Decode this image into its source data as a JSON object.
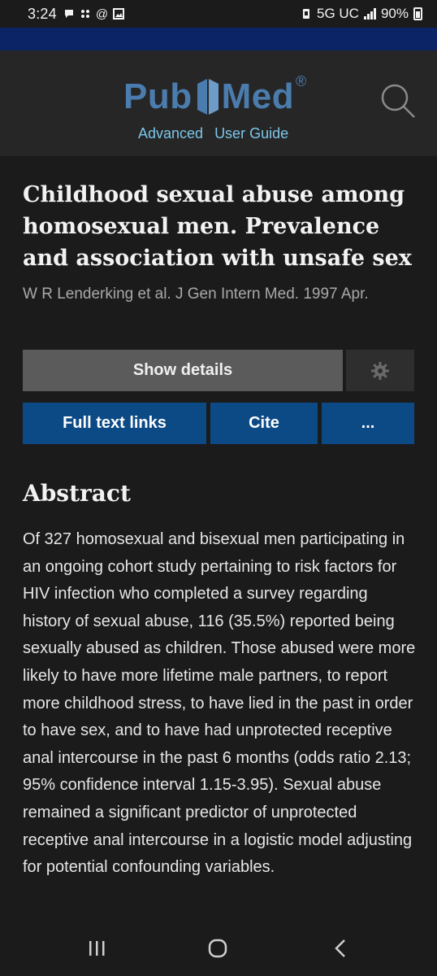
{
  "status_bar": {
    "time": "3:24",
    "network": "5G UC",
    "battery": "90%"
  },
  "header": {
    "logo_left": "Pub",
    "logo_right": "Med",
    "logo_mark": "®",
    "links": [
      "Advanced",
      "User Guide"
    ]
  },
  "article": {
    "title": "Childhood sexual abuse among homosexual men. Prevalence and association with unsafe sex",
    "citation": "W R Lenderking et al. J Gen Intern Med. 1997 Apr."
  },
  "actions": {
    "show_details": "Show details",
    "full_text_links": "Full text links",
    "cite": "Cite",
    "more": "..."
  },
  "abstract": {
    "heading": "Abstract",
    "text": "Of 327 homosexual and bisexual men participating in an ongoing cohort study pertaining to risk factors for HIV infection who completed a survey regarding history of sexual abuse, 116 (35.5%) reported being sexually abused as children. Those abused were more likely to have more lifetime male partners, to report more childhood stress, to have lied in the past in order to have sex, and to have had unprotected receptive anal intercourse in the past 6 months (odds ratio 2.13; 95% confidence interval 1.15-3.95). Sexual abuse remained a significant predictor of unprotected receptive anal intercourse in a logistic model adjusting for potential confounding variables."
  },
  "icons": {
    "search": "search-icon",
    "settings": "gear-icon",
    "nav_recent": "recent-apps-icon",
    "nav_home": "home-icon",
    "nav_back": "back-icon"
  },
  "colors": {
    "background": "#1b1b1b",
    "header": "#262626",
    "navy_strip": "#0b2465",
    "primary_button": "#0c4a86",
    "logo": "#4b7cae",
    "link": "#7cc7ea"
  }
}
